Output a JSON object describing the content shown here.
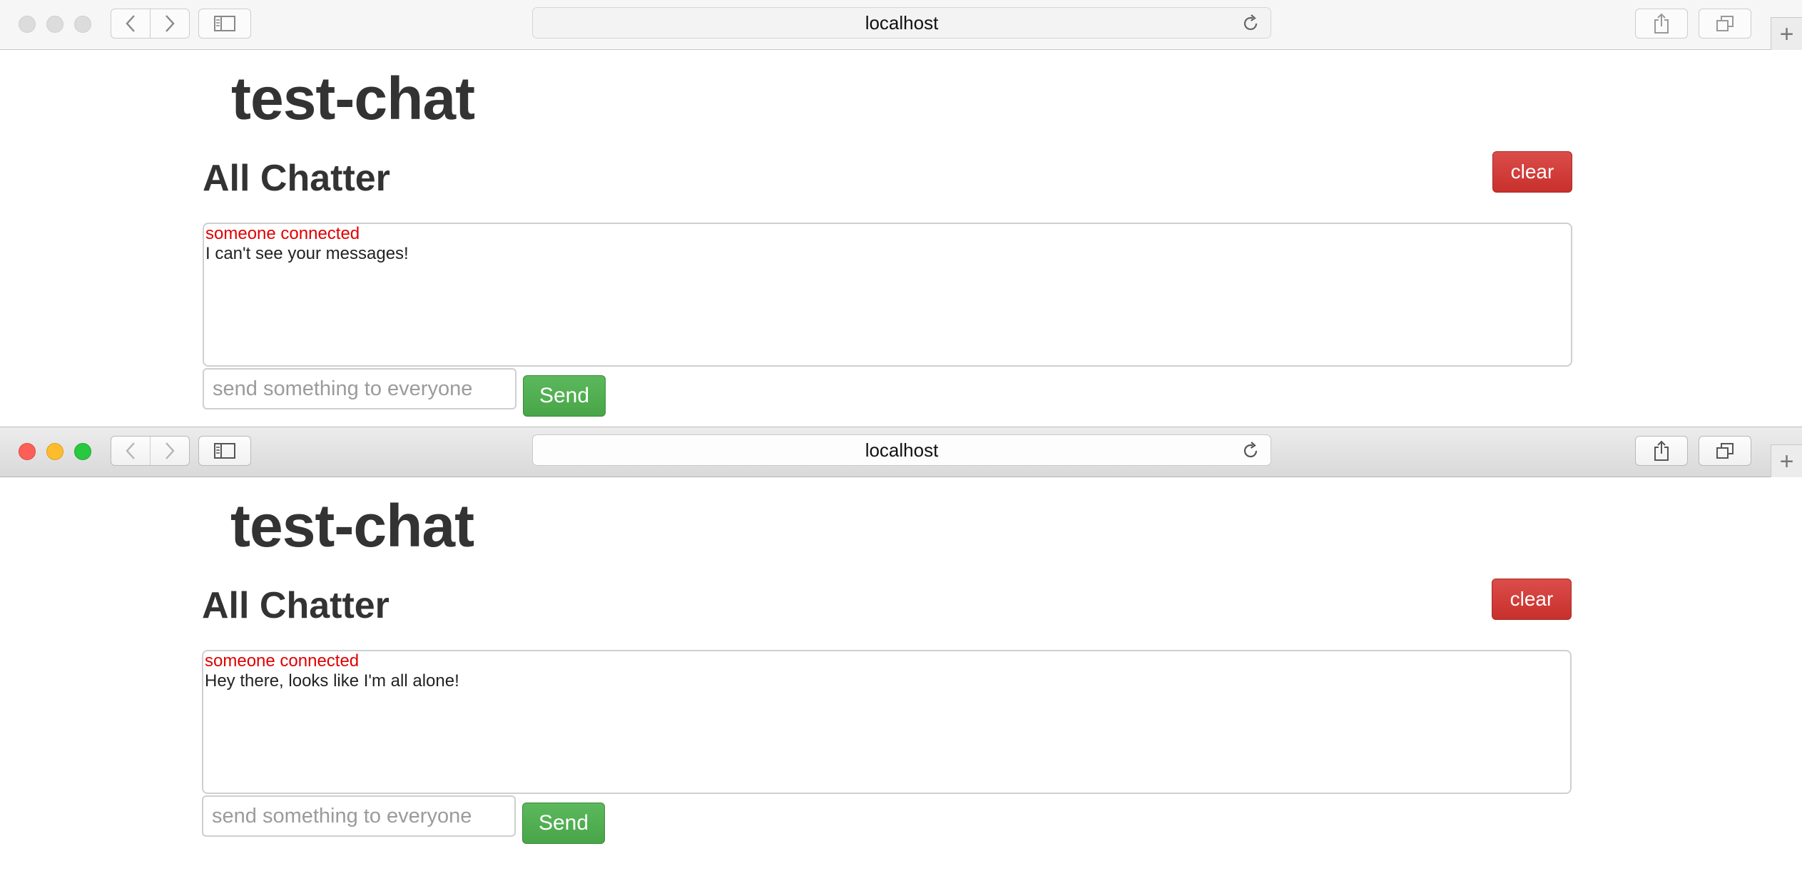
{
  "windows": [
    {
      "state": "inactive",
      "address": "localhost",
      "app_title": "test-chat",
      "section_title": "All Chatter",
      "clear_label": "clear",
      "messages": [
        {
          "type": "system",
          "text": "someone connected"
        },
        {
          "type": "user",
          "text": "I can't see your messages!"
        }
      ],
      "input_placeholder": "send something to everyone",
      "input_value": "",
      "send_label": "Send"
    },
    {
      "state": "active",
      "address": "localhost",
      "app_title": "test-chat",
      "section_title": "All Chatter",
      "clear_label": "clear",
      "messages": [
        {
          "type": "system",
          "text": "someone connected"
        },
        {
          "type": "user",
          "text": "Hey there, looks like I'm all alone!"
        }
      ],
      "input_placeholder": "send something to everyone",
      "input_value": "",
      "send_label": "Send"
    }
  ],
  "icons": {
    "back": "chevron-left-icon",
    "forward": "chevron-right-icon",
    "sidebar": "sidebar-icon",
    "reload": "reload-icon",
    "share": "share-icon",
    "tabs": "tabs-overview-icon",
    "new_tab": "plus-icon"
  },
  "colors": {
    "clear_button": "#d9534f",
    "send_button": "#5cb85c",
    "system_message": "#e00000",
    "title_text": "#333333"
  }
}
